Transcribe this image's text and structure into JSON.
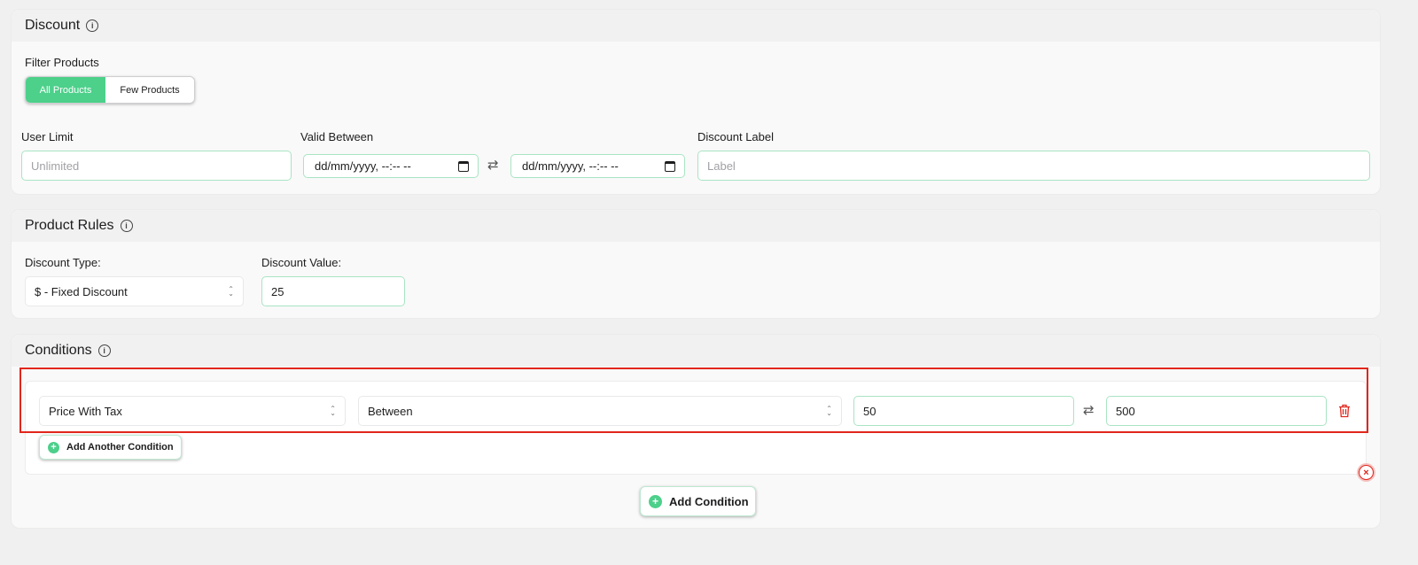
{
  "discount": {
    "title": "Discount",
    "filter_label": "Filter Products",
    "filter_options": [
      "All Products",
      "Few Products"
    ],
    "user_limit": {
      "label": "User Limit",
      "placeholder": "Unlimited"
    },
    "valid_between": {
      "label": "Valid Between",
      "start_value": "dd/mm/yyyy, --:-- --",
      "end_value": "dd/mm/yyyy, --:-- --"
    },
    "discount_label": {
      "label": "Discount Label",
      "placeholder": "Label"
    }
  },
  "product_rules": {
    "title": "Product Rules",
    "discount_type_label": "Discount Type:",
    "discount_type_value": "$ - Fixed Discount",
    "discount_value_label": "Discount Value:",
    "discount_value": "25"
  },
  "conditions": {
    "title": "Conditions",
    "rows": [
      {
        "field": "Price With Tax",
        "operator": "Between",
        "min": "50",
        "max": "500"
      }
    ],
    "add_another_label": "Add Another Condition",
    "add_condition_label": "Add Condition"
  },
  "colors": {
    "accent": "#4cd08a",
    "danger": "#e1261c",
    "input_border": "#a9e4c4"
  },
  "icons": {
    "info": "info-circle-icon",
    "swap": "swap-arrows-icon",
    "calendar": "calendar-icon",
    "trash": "trash-icon",
    "plus": "plus-circle-icon",
    "close": "close-circle-icon"
  }
}
